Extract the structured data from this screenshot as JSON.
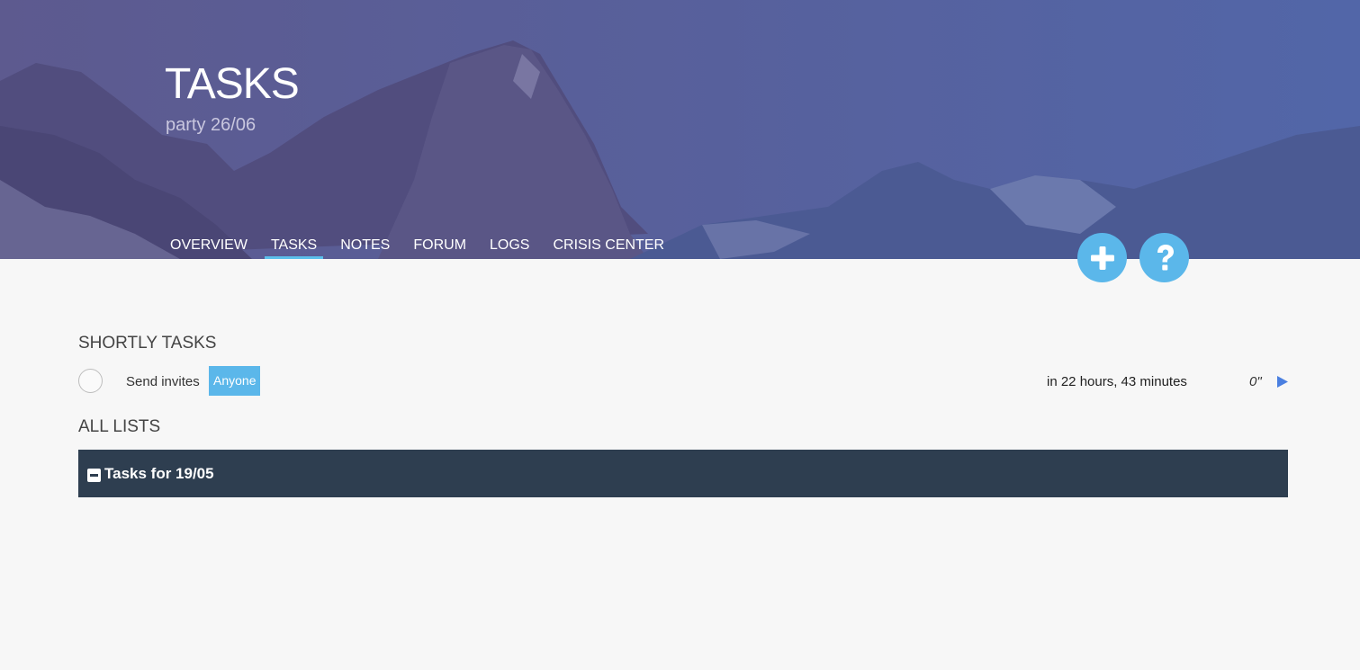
{
  "header": {
    "title": "TASKS",
    "subtitle": "party 26/06"
  },
  "nav": {
    "items": [
      {
        "label": "OVERVIEW",
        "active": false
      },
      {
        "label": "TASKS",
        "active": true
      },
      {
        "label": "NOTES",
        "active": false
      },
      {
        "label": "FORUM",
        "active": false
      },
      {
        "label": "LOGS",
        "active": false
      },
      {
        "label": "CRISIS CENTER",
        "active": false
      }
    ]
  },
  "actions": {
    "add_icon": "plus-icon",
    "help_icon": "question-icon",
    "color": "#5bb7ea"
  },
  "shortly": {
    "heading": "SHORTLY TASKS",
    "tasks": [
      {
        "name": "Send invites",
        "assignee": "Anyone",
        "due": "in 22 hours, 43 minutes",
        "timer": "0\"",
        "play_icon": "play-icon"
      }
    ]
  },
  "lists": {
    "heading": "ALL LISTS",
    "items": [
      {
        "title": "Tasks for 19/05",
        "icon": "minus-square-icon",
        "color": "#2e3e50"
      }
    ]
  }
}
